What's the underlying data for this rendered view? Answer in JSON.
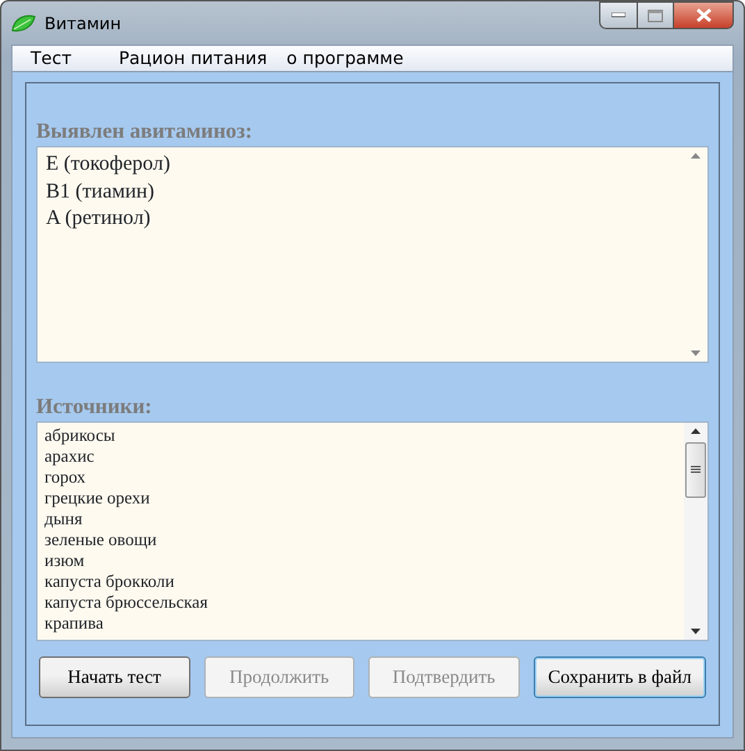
{
  "window": {
    "title": "Витамин"
  },
  "menu": [
    {
      "label": "Тест"
    },
    {
      "label": "Рацион питания"
    },
    {
      "label": "о программе"
    }
  ],
  "deficiency": {
    "label": "Выявлен авитаминоз:",
    "lines": [
      "E (токоферол)",
      "B1 (тиамин)",
      "A (ретинол)"
    ]
  },
  "sources": {
    "label": "Источники:",
    "items": [
      "абрикосы",
      "арахис",
      "горох",
      "грецкие орехи",
      "дыня",
      "зеленые овощи",
      "изюм",
      "капуста брокколи",
      "капуста брюссельская",
      "крапива"
    ]
  },
  "buttons": [
    {
      "label": "Начать тест",
      "disabled": false,
      "focused": false
    },
    {
      "label": "Продолжить",
      "disabled": true,
      "focused": false
    },
    {
      "label": "Подтвердить",
      "disabled": true,
      "focused": false
    },
    {
      "label": "Сохранить в файл",
      "disabled": false,
      "focused": true
    }
  ]
}
